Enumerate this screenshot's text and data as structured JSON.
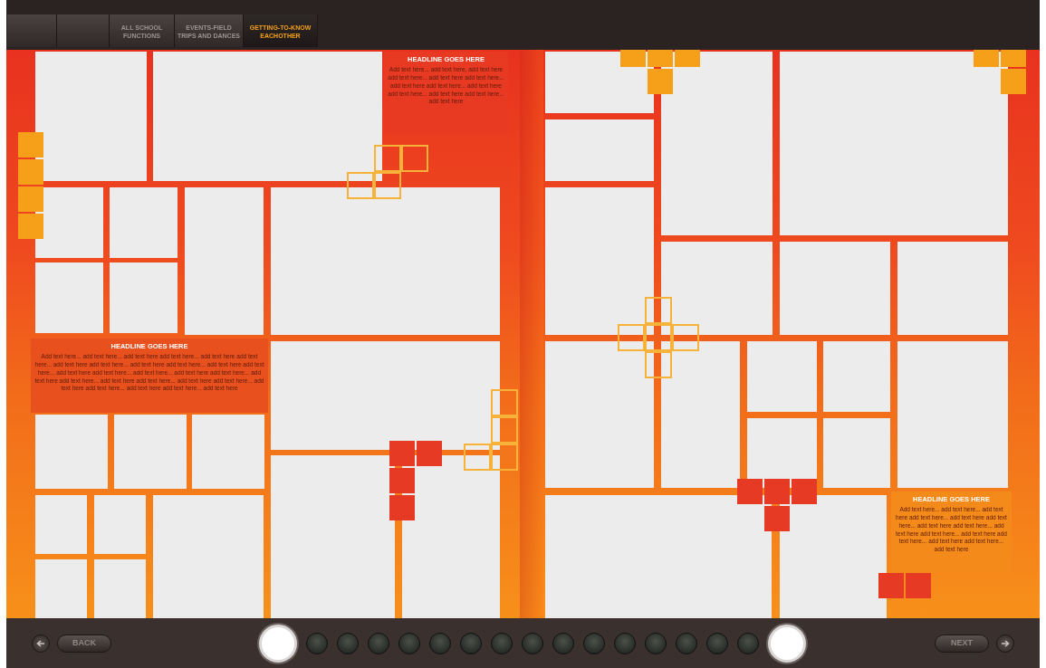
{
  "tabs": [
    {
      "selected": false
    },
    {
      "selected": false
    },
    {
      "lines": [
        "ALL SCHOOL",
        "FUNCTIONS"
      ],
      "selected": false
    },
    {
      "lines": [
        "EVENTS-FIELD",
        "TRIPS AND DANCES"
      ],
      "selected": false
    },
    {
      "lines": [
        "GETTING-TO-KNOW",
        "EACHOTHER"
      ],
      "selected": true
    }
  ],
  "text_blocks": [
    {
      "headline": "HEADLINE GOES HERE",
      "body": "Add text here... add text here, add text here add text here... add text here add text here... add text here add text here... add text here add text here... add text here add text here... add text here"
    },
    {
      "headline": "HEADLINE GOES HERE",
      "body": "Add text here... add text here... add text here add text here... add text here add text here... add text here add text here... add text here add text here... add text here add text here... add text here add text here... add text here... add text here add text here... add text here add text here... add text here add text here... add text here add text here... add text here add text here... add text here add text here... add text here"
    },
    {
      "headline": "HEADLINE GOES HERE",
      "body": "Add text here... add text here... add text here add text here... add text here add text here... add text here add text here... add text here add text here... add text here add text here... add text here add text here... add text here"
    }
  ],
  "navigation": {
    "back_label": "BACK",
    "next_label": "NEXT"
  },
  "pager": [
    {
      "selected": true
    },
    {
      "selected": false
    },
    {
      "selected": false
    },
    {
      "selected": false
    },
    {
      "selected": false
    },
    {
      "selected": false
    },
    {
      "selected": false
    },
    {
      "selected": false
    },
    {
      "selected": false
    },
    {
      "selected": false
    },
    {
      "selected": false
    },
    {
      "selected": false
    },
    {
      "selected": false
    },
    {
      "selected": false
    },
    {
      "selected": false
    },
    {
      "selected": false
    },
    {
      "selected": true
    }
  ]
}
